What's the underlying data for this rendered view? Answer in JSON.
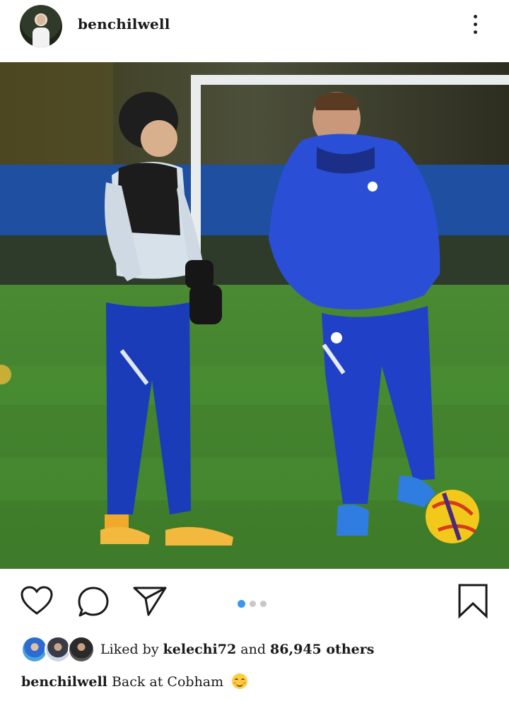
{
  "post": {
    "username": "benchilwell",
    "carousel": {
      "count": 3,
      "active_index": 0
    },
    "likes": {
      "prefix": "Liked by",
      "user": "kelechi72",
      "joiner": "and",
      "others": "86,945 others"
    },
    "caption": {
      "username": "benchilwell",
      "text": "Back at Cobham"
    }
  },
  "icons": {
    "more": "more-vertical-icon",
    "like": "heart-icon",
    "comment": "comment-icon",
    "share": "send-icon",
    "save": "bookmark-icon",
    "emoji": "smiling-face-emoji"
  },
  "colors": {
    "accent": "#3897f0",
    "kit_blue": "#1e3fc4",
    "pitch_green": "#3f8a2f"
  }
}
